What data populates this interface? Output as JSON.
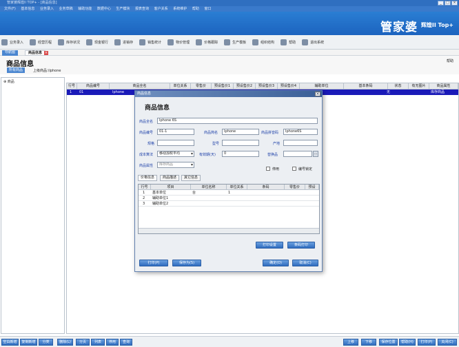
{
  "window": {
    "title": "管家婆辉煌II TOP+ - [商品信息]",
    "menu": [
      "文件(F)",
      "基本信息",
      "业务录入",
      "业务草稿",
      "辅助功能",
      "数据中心",
      "生产模块",
      "报表查询",
      "客户关系",
      "系统维护",
      "帮助",
      "窗口"
    ]
  },
  "brand": {
    "name": "管家婆",
    "subtitle": "辉煌II Top+"
  },
  "toolbar": [
    {
      "label": "业务录入",
      "icon": "pencil-icon"
    },
    {
      "label": "经营历程",
      "icon": "chart-icon"
    },
    {
      "label": "库存状况",
      "icon": "box-icon"
    },
    {
      "label": "现金银行",
      "icon": "bank-icon"
    },
    {
      "label": "进销存",
      "icon": "table-icon"
    },
    {
      "label": "销售统计",
      "icon": "pie-icon"
    },
    {
      "label": "物价管理",
      "icon": "tag-icon"
    },
    {
      "label": "价格跟踪",
      "icon": "track-icon"
    },
    {
      "label": "生产模板",
      "icon": "tools-icon"
    },
    {
      "label": "组织结构",
      "icon": "org-icon"
    },
    {
      "label": "帮助",
      "icon": "help-icon"
    },
    {
      "label": "退出系统",
      "icon": "exit-icon"
    }
  ],
  "tabs": [
    "导航图",
    "商品信息"
  ],
  "page": {
    "title": "商品信息",
    "help": "帮助",
    "crumb_button": "所有商品",
    "crumb_path": "上级商品:\\Iphone"
  },
  "tree": {
    "root": "商品"
  },
  "grid": {
    "headers": [
      "行号",
      "商品编号",
      "商品全名",
      "单位关系",
      "零售价",
      "预设售价1",
      "预设售价2",
      "预设售价3",
      "预设售价4",
      "辅助单位",
      "基本条码",
      "状态",
      "有无图片",
      "商品属性"
    ],
    "row": {
      "num": "1",
      "code": "01",
      "name": "Iphone",
      "status": "无",
      "attr": "库存商品"
    }
  },
  "dialog": {
    "window_title": "商品信息",
    "heading": "商品信息",
    "fields": {
      "full_name": {
        "label": "商品全名",
        "value": "Iphone 6S"
      },
      "code": {
        "label": "商品编号",
        "value": "01-1"
      },
      "short_name": {
        "label": "商品简名",
        "value": "Iphone"
      },
      "pinyin": {
        "label": "商品拼音码",
        "value": "Iphone6S"
      },
      "spec": {
        "label": "规格",
        "value": ""
      },
      "model": {
        "label": "型号",
        "value": ""
      },
      "origin": {
        "label": "产地",
        "value": ""
      },
      "cost_method": {
        "label": "成本算法",
        "value": "移动加权平均"
      },
      "shelf_life": {
        "label": "有效期(天)",
        "value": "0"
      },
      "substitute": {
        "label": "替换品",
        "value": ""
      },
      "attr": {
        "label": "商品属性",
        "value": "库存商品"
      },
      "disabled": {
        "label": "停用",
        "checked": false
      },
      "lock_code": {
        "label": "编号锁定",
        "checked": false
      }
    },
    "subtabs": [
      "价格信息",
      "商品描述",
      "其它信息"
    ],
    "subgrid": {
      "headers": [
        "行号",
        "项目",
        "单位名称",
        "单位关系",
        "条码",
        "零售价",
        "预设"
      ],
      "rows": [
        {
          "num": "1",
          "item": "基本单位",
          "unit": "台",
          "rel": "1"
        },
        {
          "num": "2",
          "item": "辅助单位1",
          "unit": "",
          "rel": ""
        },
        {
          "num": "3",
          "item": "辅助单位2",
          "unit": "",
          "rel": ""
        }
      ]
    },
    "buttons": {
      "print_settings": "打印设置",
      "barcode_print": "条码打印",
      "print": "打印(P)",
      "save_as": "保存为(S)",
      "ok": "确定(O)",
      "cancel": "取消(C)"
    }
  },
  "bottom": {
    "left": [
      "空白新增",
      "复制新增",
      "分类",
      "删除(L)",
      "分页",
      "列表",
      "停用",
      "查询"
    ],
    "right": [
      "上移",
      "下移",
      "保存位置",
      "帮助(H)",
      "打印(P)",
      "关闭(C)"
    ]
  },
  "colors": {
    "accent": "#2a7ed3",
    "selected_row": "#1a1ab8"
  }
}
